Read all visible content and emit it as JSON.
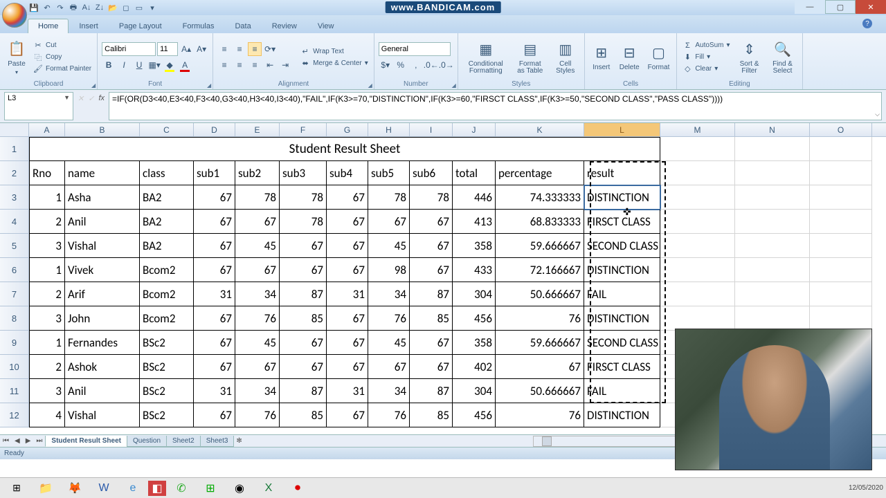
{
  "watermark": "www.BANDICAM.com",
  "tabs": [
    "Home",
    "Insert",
    "Page Layout",
    "Formulas",
    "Data",
    "Review",
    "View"
  ],
  "clipboard": {
    "label": "Clipboard",
    "paste": "Paste",
    "cut": "Cut",
    "copy": "Copy",
    "fmtpainter": "Format Painter"
  },
  "font": {
    "label": "Font",
    "name": "Calibri",
    "size": "11"
  },
  "alignment": {
    "label": "Alignment",
    "wrap": "Wrap Text",
    "merge": "Merge & Center"
  },
  "number": {
    "label": "Number",
    "format": "General"
  },
  "styles": {
    "label": "Styles",
    "cond": "Conditional Formatting",
    "fmt": "Format as Table",
    "cell": "Cell Styles"
  },
  "cells": {
    "label": "Cells",
    "ins": "Insert",
    "del": "Delete",
    "fmt": "Format"
  },
  "editing": {
    "label": "Editing",
    "sum": "AutoSum",
    "fill": "Fill",
    "clear": "Clear",
    "sort": "Sort & Filter",
    "find": "Find & Select"
  },
  "namebox": "L3",
  "formula": "=IF(OR(D3<40,E3<40,F3<40,G3<40,H3<40,I3<40),\"FAIL\",IF(K3>=70,\"DISTINCTION\",IF(K3>=60,\"FIRSCT CLASS\",IF(K3>=50,\"SECOND CLASS\",\"PASS CLASS\"))))",
  "cols": [
    "A",
    "B",
    "C",
    "D",
    "E",
    "F",
    "G",
    "H",
    "I",
    "J",
    "K",
    "L",
    "M",
    "N",
    "O"
  ],
  "title": "Student Result Sheet",
  "headers": [
    "Rno",
    "name",
    "class",
    "sub1",
    "sub2",
    "sub3",
    "sub4",
    "sub5",
    "sub6",
    "total",
    "percentage",
    "result"
  ],
  "rows": [
    {
      "n": "3",
      "d": [
        "1",
        "Asha",
        "BA2",
        "67",
        "78",
        "78",
        "67",
        "78",
        "78",
        "446",
        "74.333333",
        "DISTINCTION"
      ]
    },
    {
      "n": "4",
      "d": [
        "2",
        "Anil",
        "BA2",
        "67",
        "67",
        "78",
        "67",
        "67",
        "67",
        "413",
        "68.833333",
        "FIRSCT CLASS"
      ]
    },
    {
      "n": "5",
      "d": [
        "3",
        "Vishal",
        "BA2",
        "67",
        "45",
        "67",
        "67",
        "45",
        "67",
        "358",
        "59.666667",
        "SECOND CLASS"
      ]
    },
    {
      "n": "6",
      "d": [
        "1",
        "Vivek",
        "Bcom2",
        "67",
        "67",
        "67",
        "67",
        "98",
        "67",
        "433",
        "72.166667",
        "DISTINCTION"
      ]
    },
    {
      "n": "7",
      "d": [
        "2",
        "Arif",
        "Bcom2",
        "31",
        "34",
        "87",
        "31",
        "34",
        "87",
        "304",
        "50.666667",
        "FAIL"
      ]
    },
    {
      "n": "8",
      "d": [
        "3",
        "John",
        "Bcom2",
        "67",
        "76",
        "85",
        "67",
        "76",
        "85",
        "456",
        "76",
        "DISTINCTION"
      ]
    },
    {
      "n": "9",
      "d": [
        "1",
        "Fernandes",
        "BSc2",
        "67",
        "45",
        "67",
        "67",
        "45",
        "67",
        "358",
        "59.666667",
        "SECOND CLASS"
      ]
    },
    {
      "n": "10",
      "d": [
        "2",
        "Ashok",
        "BSc2",
        "67",
        "67",
        "67",
        "67",
        "67",
        "67",
        "402",
        "67",
        "FIRSCT CLASS"
      ]
    },
    {
      "n": "11",
      "d": [
        "3",
        "Anil",
        "BSc2",
        "31",
        "34",
        "87",
        "31",
        "34",
        "87",
        "304",
        "50.666667",
        "FAIL"
      ]
    },
    {
      "n": "12",
      "d": [
        "4",
        "Vishal",
        "BSc2",
        "67",
        "76",
        "85",
        "67",
        "76",
        "85",
        "456",
        "76",
        "DISTINCTION"
      ]
    }
  ],
  "sheets": [
    "Student Result Sheet",
    "Question",
    "Sheet2",
    "Sheet3"
  ],
  "status": "Ready",
  "clock": "12/05/2020"
}
